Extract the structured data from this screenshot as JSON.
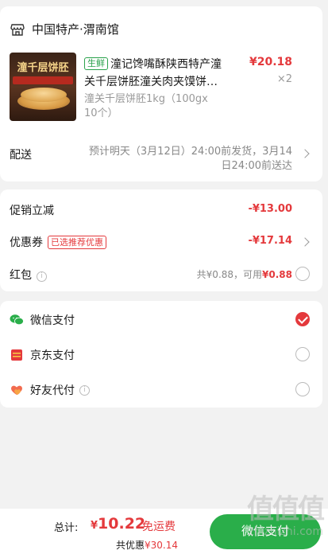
{
  "shop": {
    "name": "中国特产·渭南馆"
  },
  "product": {
    "image_banner": "潼千层饼胚",
    "fresh_tag": "生鲜",
    "title": "潼记馋嘴酥陕西特产潼关千层饼胚潼关肉夹馍饼…",
    "price": "¥20.18",
    "qty": "×2",
    "spec": "潼关千层饼胚1kg（100gx 10个）"
  },
  "delivery": {
    "label": "配送",
    "text": "预计明天（3月12日）24:00前发货，3月14日24:00前送达"
  },
  "discounts": {
    "promo": {
      "label": "促销立减",
      "value": "-¥13.00"
    },
    "coupon": {
      "label": "优惠券",
      "tag": "已选推荐优惠",
      "value": "-¥17.14"
    },
    "hongbao": {
      "label": "红包",
      "prefix": "共¥0.88，可用",
      "available": "¥0.88"
    }
  },
  "payment": {
    "options": [
      {
        "label": "微信支付",
        "icon": "wechat-pay-icon",
        "selected": true
      },
      {
        "label": "京东支付",
        "icon": "jd-pay-icon",
        "selected": false
      },
      {
        "label": "好友代付",
        "icon": "friend-pay-icon",
        "selected": false
      }
    ]
  },
  "footer": {
    "total_label": "总计:",
    "currency": "¥",
    "total": "10.22",
    "free_shipping": "免运费",
    "saving_prefix": "共优惠",
    "saving": "¥30.14",
    "pay_button": "微信支付"
  },
  "watermark": {
    "big": "值值值",
    "url": "zhizhizhi.com"
  },
  "colors": {
    "accent": "#e4393c",
    "wechat_green": "#2aae4a",
    "fresh_green": "#2ba24c"
  }
}
